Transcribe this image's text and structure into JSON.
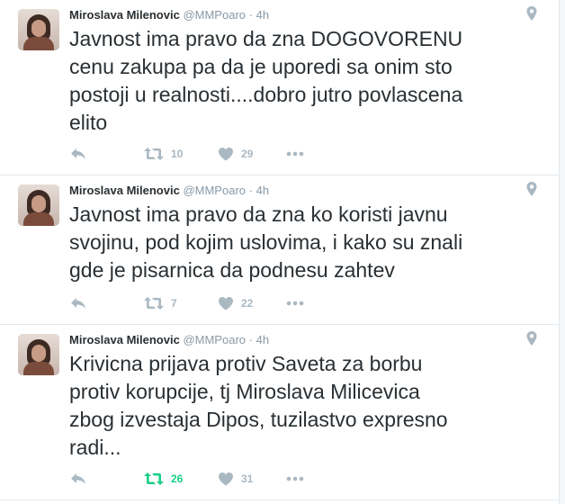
{
  "colors": {
    "icon_grey": "#aab8c2",
    "retweeted_green": "#19cf86",
    "text": "#292f33",
    "meta": "#8899a6"
  },
  "icons": {
    "reply": "reply-icon",
    "retweet": "retweet-icon",
    "like": "heart-icon",
    "more": "more-icon",
    "location": "location-pin-icon"
  },
  "tweets": [
    {
      "author": "Miroslava Milenovic",
      "handle": "@MMPoaro",
      "separator": "·",
      "time": "4h",
      "text": "Javnost ima pravo da zna DOGOVORENU\ncenu zakupa pa da je uporedi sa onim sto\npostoji u realnosti....dobro jutro povlascena\nelito",
      "retweets": "10",
      "likes": "29",
      "retweeted": false
    },
    {
      "author": "Miroslava Milenovic",
      "handle": "@MMPoaro",
      "separator": "·",
      "time": "4h",
      "text": "Javnost ima pravo da zna ko koristi javnu\nsvojinu, pod kojim uslovima, i kako su znali\ngde je pisarnica da podnesu zahtev",
      "retweets": "7",
      "likes": "22",
      "retweeted": false
    },
    {
      "author": "Miroslava Milenovic",
      "handle": "@MMPoaro",
      "separator": "·",
      "time": "4h",
      "text": "Krivicna prijava protiv Saveta za borbu\nprotiv korupcije, tj Miroslava Milicevica\nzbog izvestaja Dipos, tuzilastvo expresno\nradi...",
      "retweets": "26",
      "likes": "31",
      "retweeted": true
    }
  ]
}
